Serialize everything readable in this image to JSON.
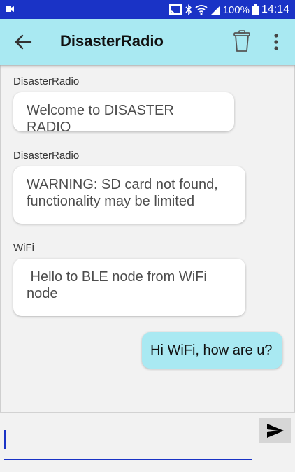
{
  "status_bar": {
    "battery": "100%",
    "time": "14:14",
    "icons": [
      "video-camera-icon",
      "cast-icon",
      "bluetooth-icon",
      "wifi-icon",
      "signal-icon",
      "battery-icon"
    ]
  },
  "app_bar": {
    "title": "DisasterRadio",
    "icons": [
      "back-arrow-icon",
      "trash-icon",
      "more-vert-icon"
    ]
  },
  "messages": [
    {
      "sender": "DisasterRadio",
      "text": "Welcome to DISASTER RADIO",
      "direction": "incoming"
    },
    {
      "sender": "DisasterRadio",
      "lines": [
        "WARNING: SD card not found,",
        "functionality may be limited"
      ],
      "direction": "incoming"
    },
    {
      "sender": "WiFi",
      "lines": [
        " Hello to BLE node from WiFi",
        "node"
      ],
      "direction": "incoming"
    },
    {
      "sender": "",
      "text": "Hi WiFi, how are u?",
      "direction": "outgoing"
    }
  ],
  "composer": {
    "value": "",
    "send_icon": "send-icon"
  },
  "colors": {
    "status_bar": "#1a33c6",
    "app_bar": "#a9e9f2",
    "outgoing_bubble": "#a9e9f2",
    "incoming_bubble": "#ffffff",
    "background": "#f2f2f2"
  }
}
